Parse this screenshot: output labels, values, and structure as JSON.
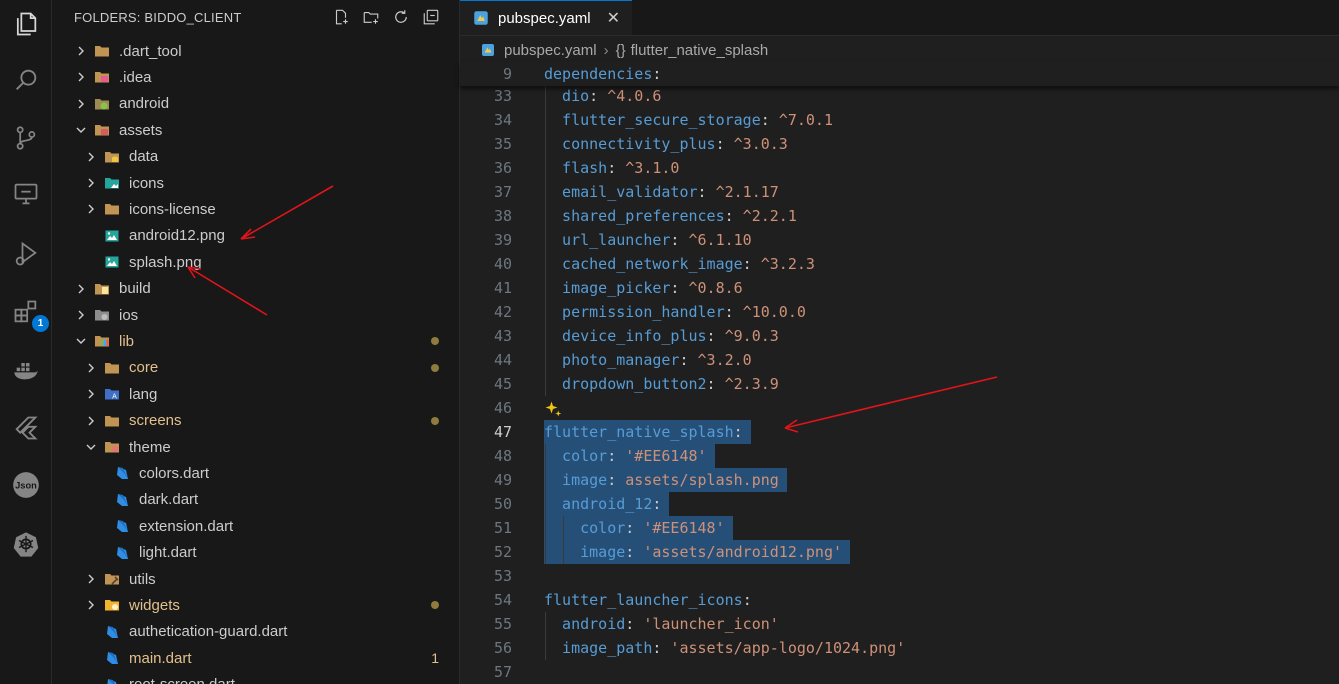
{
  "sidebar": {
    "title": "FOLDERS: BIDDO_CLIENT",
    "tree": [
      {
        "label": ".dart_tool",
        "depth": 0,
        "chevron": "right",
        "icon": "folder-icon",
        "modified": false
      },
      {
        "label": ".idea",
        "depth": 0,
        "chevron": "right",
        "icon": "idea-folder-icon",
        "modified": false
      },
      {
        "label": "android",
        "depth": 0,
        "chevron": "right",
        "icon": "android-folder-icon",
        "modified": false
      },
      {
        "label": "assets",
        "depth": 0,
        "chevron": "down",
        "icon": "assets-folder-icon",
        "modified": false
      },
      {
        "label": "data",
        "depth": 1,
        "chevron": "right",
        "icon": "data-folder-icon",
        "modified": false
      },
      {
        "label": "icons",
        "depth": 1,
        "chevron": "right",
        "icon": "images-folder-icon",
        "modified": false
      },
      {
        "label": "icons-license",
        "depth": 1,
        "chevron": "right",
        "icon": "folder-icon",
        "modified": false
      },
      {
        "label": "android12.png",
        "depth": 1,
        "chevron": "none",
        "icon": "image-file-icon",
        "modified": false
      },
      {
        "label": "splash.png",
        "depth": 1,
        "chevron": "none",
        "icon": "image-file-icon",
        "modified": false
      },
      {
        "label": "build",
        "depth": 0,
        "chevron": "right",
        "icon": "build-folder-icon",
        "modified": false
      },
      {
        "label": "ios",
        "depth": 0,
        "chevron": "right",
        "icon": "ios-folder-icon",
        "modified": false
      },
      {
        "label": "lib",
        "depth": 0,
        "chevron": "down",
        "icon": "lib-folder-icon",
        "modified": true,
        "marker": "dot"
      },
      {
        "label": "core",
        "depth": 1,
        "chevron": "right",
        "icon": "folder-icon",
        "modified": true,
        "marker": "dot"
      },
      {
        "label": "lang",
        "depth": 1,
        "chevron": "right",
        "icon": "lang-folder-icon",
        "modified": false
      },
      {
        "label": "screens",
        "depth": 1,
        "chevron": "right",
        "icon": "folder-icon",
        "modified": true,
        "marker": "dot"
      },
      {
        "label": "theme",
        "depth": 1,
        "chevron": "down",
        "icon": "theme-folder-icon",
        "modified": false
      },
      {
        "label": "colors.dart",
        "depth": 2,
        "chevron": "none",
        "icon": "dart-file-icon",
        "modified": false
      },
      {
        "label": "dark.dart",
        "depth": 2,
        "chevron": "none",
        "icon": "dart-file-icon",
        "modified": false
      },
      {
        "label": "extension.dart",
        "depth": 2,
        "chevron": "none",
        "icon": "dart-file-icon",
        "modified": false
      },
      {
        "label": "light.dart",
        "depth": 2,
        "chevron": "none",
        "icon": "dart-file-icon",
        "modified": false
      },
      {
        "label": "utils",
        "depth": 1,
        "chevron": "right",
        "icon": "utils-folder-icon",
        "modified": false
      },
      {
        "label": "widgets",
        "depth": 1,
        "chevron": "right",
        "icon": "widgets-folder-icon",
        "modified": true,
        "marker": "dot"
      },
      {
        "label": "authetication-guard.dart",
        "depth": 1,
        "chevron": "none",
        "icon": "dart-file-icon",
        "modified": false
      },
      {
        "label": "main.dart",
        "depth": 1,
        "chevron": "none",
        "icon": "dart-file-icon",
        "modified": true,
        "marker": "count",
        "count": "1"
      },
      {
        "label": "root-screen.dart",
        "depth": 1,
        "chevron": "none",
        "icon": "dart-file-icon",
        "modified": false
      }
    ]
  },
  "activity_bar": {
    "icons": [
      "explorer-icon",
      "search-icon",
      "source-control-icon",
      "remote-explorer-icon",
      "run-debug-icon",
      "extensions-icon",
      "docker-icon",
      "flutter-icon",
      "json-icon",
      "kubernetes-icon"
    ],
    "extensions_badge": "1"
  },
  "editor": {
    "tab_label": "pubspec.yaml",
    "breadcrumb_file": "pubspec.yaml",
    "breadcrumb_symbol_glyph": "{}",
    "breadcrumb_symbol": "flutter_native_splash",
    "sticky_line": {
      "n": "9",
      "key": "dependencies",
      "indent": 0
    },
    "lines": [
      {
        "n": "33",
        "indent": 1,
        "key": "dio",
        "value": "^4.0.6"
      },
      {
        "n": "34",
        "indent": 1,
        "key": "flutter_secure_storage",
        "value": "^7.0.1"
      },
      {
        "n": "35",
        "indent": 1,
        "key": "connectivity_plus",
        "value": "^3.0.3"
      },
      {
        "n": "36",
        "indent": 1,
        "key": "flash",
        "value": "^3.1.0"
      },
      {
        "n": "37",
        "indent": 1,
        "key": "email_validator",
        "value": "^2.1.17"
      },
      {
        "n": "38",
        "indent": 1,
        "key": "shared_preferences",
        "value": "^2.2.1"
      },
      {
        "n": "39",
        "indent": 1,
        "key": "url_launcher",
        "value": "^6.1.10"
      },
      {
        "n": "40",
        "indent": 1,
        "key": "cached_network_image",
        "value": "^3.2.3"
      },
      {
        "n": "41",
        "indent": 1,
        "key": "image_picker",
        "value": "^0.8.6"
      },
      {
        "n": "42",
        "indent": 1,
        "key": "permission_handler",
        "value": "^10.0.0"
      },
      {
        "n": "43",
        "indent": 1,
        "key": "device_info_plus",
        "value": "^9.0.3"
      },
      {
        "n": "44",
        "indent": 1,
        "key": "photo_manager",
        "value": "^3.2.0"
      },
      {
        "n": "45",
        "indent": 1,
        "key": "dropdown_button2",
        "value": "^2.3.9"
      },
      {
        "n": "46",
        "indent": 0,
        "key": "",
        "value": "",
        "sparkle": true
      },
      {
        "n": "47",
        "indent": 0,
        "key": "flutter_native_splash",
        "value": "",
        "selected": true,
        "active": true
      },
      {
        "n": "48",
        "indent": 1,
        "key": "color",
        "value": "'#EE6148'",
        "selected": true
      },
      {
        "n": "49",
        "indent": 1,
        "key": "image",
        "value": "assets/splash.png",
        "selected": true
      },
      {
        "n": "50",
        "indent": 1,
        "key": "android_12",
        "value": "",
        "selected": true
      },
      {
        "n": "51",
        "indent": 2,
        "key": "color",
        "value": "'#EE6148'",
        "selected": true
      },
      {
        "n": "52",
        "indent": 2,
        "key": "image",
        "value": "'assets/android12.png'",
        "selected": true
      },
      {
        "n": "53",
        "indent": 0,
        "key": "",
        "value": ""
      },
      {
        "n": "54",
        "indent": 0,
        "key": "flutter_launcher_icons",
        "value": ""
      },
      {
        "n": "55",
        "indent": 1,
        "key": "android",
        "value": "'launcher_icon'"
      },
      {
        "n": "56",
        "indent": 1,
        "key": "image_path",
        "value": "'assets/app-logo/1024.png'"
      },
      {
        "n": "57",
        "indent": 0,
        "key": "",
        "value": ""
      }
    ]
  },
  "colors": {
    "key": "#569cd6",
    "value": "#ce9178",
    "selection": "#264f78",
    "modified": "#e2c08d",
    "annotation_arrow": "#e0141a"
  }
}
